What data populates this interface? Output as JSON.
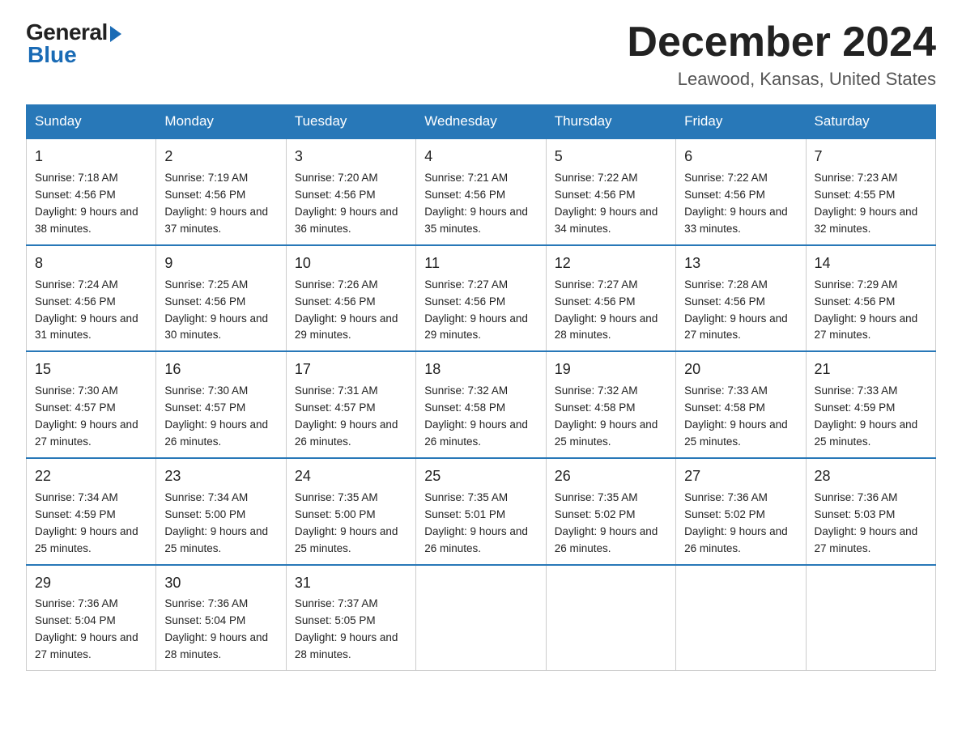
{
  "header": {
    "logo_general": "General",
    "logo_blue": "Blue",
    "month_title": "December 2024",
    "location": "Leawood, Kansas, United States"
  },
  "days_of_week": [
    "Sunday",
    "Monday",
    "Tuesday",
    "Wednesday",
    "Thursday",
    "Friday",
    "Saturday"
  ],
  "weeks": [
    [
      {
        "day": "1",
        "sunrise": "7:18 AM",
        "sunset": "4:56 PM",
        "daylight": "9 hours and 38 minutes."
      },
      {
        "day": "2",
        "sunrise": "7:19 AM",
        "sunset": "4:56 PM",
        "daylight": "9 hours and 37 minutes."
      },
      {
        "day": "3",
        "sunrise": "7:20 AM",
        "sunset": "4:56 PM",
        "daylight": "9 hours and 36 minutes."
      },
      {
        "day": "4",
        "sunrise": "7:21 AM",
        "sunset": "4:56 PM",
        "daylight": "9 hours and 35 minutes."
      },
      {
        "day": "5",
        "sunrise": "7:22 AM",
        "sunset": "4:56 PM",
        "daylight": "9 hours and 34 minutes."
      },
      {
        "day": "6",
        "sunrise": "7:22 AM",
        "sunset": "4:56 PM",
        "daylight": "9 hours and 33 minutes."
      },
      {
        "day": "7",
        "sunrise": "7:23 AM",
        "sunset": "4:55 PM",
        "daylight": "9 hours and 32 minutes."
      }
    ],
    [
      {
        "day": "8",
        "sunrise": "7:24 AM",
        "sunset": "4:56 PM",
        "daylight": "9 hours and 31 minutes."
      },
      {
        "day": "9",
        "sunrise": "7:25 AM",
        "sunset": "4:56 PM",
        "daylight": "9 hours and 30 minutes."
      },
      {
        "day": "10",
        "sunrise": "7:26 AM",
        "sunset": "4:56 PM",
        "daylight": "9 hours and 29 minutes."
      },
      {
        "day": "11",
        "sunrise": "7:27 AM",
        "sunset": "4:56 PM",
        "daylight": "9 hours and 29 minutes."
      },
      {
        "day": "12",
        "sunrise": "7:27 AM",
        "sunset": "4:56 PM",
        "daylight": "9 hours and 28 minutes."
      },
      {
        "day": "13",
        "sunrise": "7:28 AM",
        "sunset": "4:56 PM",
        "daylight": "9 hours and 27 minutes."
      },
      {
        "day": "14",
        "sunrise": "7:29 AM",
        "sunset": "4:56 PM",
        "daylight": "9 hours and 27 minutes."
      }
    ],
    [
      {
        "day": "15",
        "sunrise": "7:30 AM",
        "sunset": "4:57 PM",
        "daylight": "9 hours and 27 minutes."
      },
      {
        "day": "16",
        "sunrise": "7:30 AM",
        "sunset": "4:57 PM",
        "daylight": "9 hours and 26 minutes."
      },
      {
        "day": "17",
        "sunrise": "7:31 AM",
        "sunset": "4:57 PM",
        "daylight": "9 hours and 26 minutes."
      },
      {
        "day": "18",
        "sunrise": "7:32 AM",
        "sunset": "4:58 PM",
        "daylight": "9 hours and 26 minutes."
      },
      {
        "day": "19",
        "sunrise": "7:32 AM",
        "sunset": "4:58 PM",
        "daylight": "9 hours and 25 minutes."
      },
      {
        "day": "20",
        "sunrise": "7:33 AM",
        "sunset": "4:58 PM",
        "daylight": "9 hours and 25 minutes."
      },
      {
        "day": "21",
        "sunrise": "7:33 AM",
        "sunset": "4:59 PM",
        "daylight": "9 hours and 25 minutes."
      }
    ],
    [
      {
        "day": "22",
        "sunrise": "7:34 AM",
        "sunset": "4:59 PM",
        "daylight": "9 hours and 25 minutes."
      },
      {
        "day": "23",
        "sunrise": "7:34 AM",
        "sunset": "5:00 PM",
        "daylight": "9 hours and 25 minutes."
      },
      {
        "day": "24",
        "sunrise": "7:35 AM",
        "sunset": "5:00 PM",
        "daylight": "9 hours and 25 minutes."
      },
      {
        "day": "25",
        "sunrise": "7:35 AM",
        "sunset": "5:01 PM",
        "daylight": "9 hours and 26 minutes."
      },
      {
        "day": "26",
        "sunrise": "7:35 AM",
        "sunset": "5:02 PM",
        "daylight": "9 hours and 26 minutes."
      },
      {
        "day": "27",
        "sunrise": "7:36 AM",
        "sunset": "5:02 PM",
        "daylight": "9 hours and 26 minutes."
      },
      {
        "day": "28",
        "sunrise": "7:36 AM",
        "sunset": "5:03 PM",
        "daylight": "9 hours and 27 minutes."
      }
    ],
    [
      {
        "day": "29",
        "sunrise": "7:36 AM",
        "sunset": "5:04 PM",
        "daylight": "9 hours and 27 minutes."
      },
      {
        "day": "30",
        "sunrise": "7:36 AM",
        "sunset": "5:04 PM",
        "daylight": "9 hours and 28 minutes."
      },
      {
        "day": "31",
        "sunrise": "7:37 AM",
        "sunset": "5:05 PM",
        "daylight": "9 hours and 28 minutes."
      },
      null,
      null,
      null,
      null
    ]
  ]
}
